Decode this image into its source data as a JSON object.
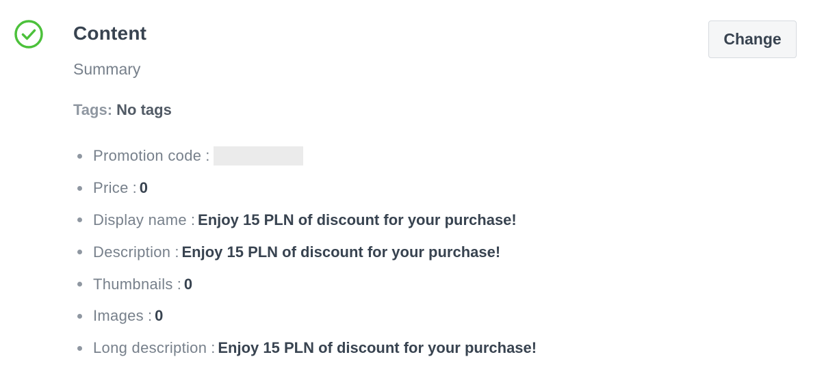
{
  "section": {
    "status_icon": "check-circle-icon",
    "status_color": "#4cc13b",
    "title": "Content",
    "subtitle": "Summary",
    "change_label": "Change"
  },
  "tags": {
    "label": "Tags:",
    "value": "No tags"
  },
  "details": [
    {
      "label": "Promotion code",
      "separator": ":",
      "value": "",
      "redacted": true
    },
    {
      "label": "Price",
      "separator": ":",
      "value": "0"
    },
    {
      "label": "Display name",
      "separator": ":",
      "value": "Enjoy 15 PLN of discount for your purchase!"
    },
    {
      "label": "Description",
      "separator": ":",
      "value": "Enjoy 15 PLN of discount for your purchase!"
    },
    {
      "label": "Thumbnails",
      "separator": ":",
      "value": "0"
    },
    {
      "label": "Images",
      "separator": ":",
      "value": "0"
    },
    {
      "label": "Long description",
      "separator": ":",
      "value": "Enjoy 15 PLN of discount for your purchase!"
    }
  ]
}
